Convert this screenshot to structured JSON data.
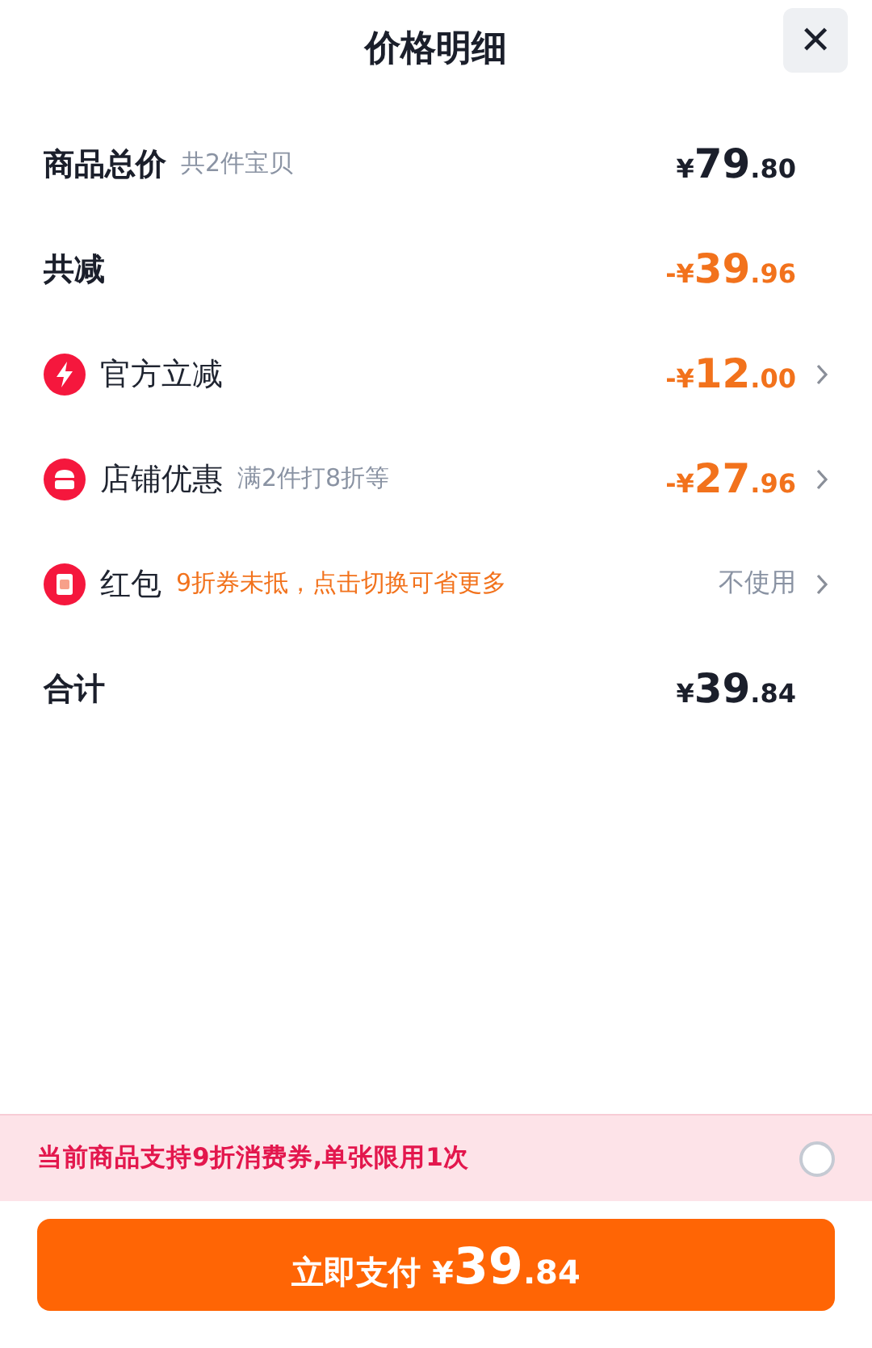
{
  "title": "价格明细",
  "close_label": "✕",
  "rows": [
    {
      "kind": "plain",
      "label": "商品总价",
      "note": "共2件宝贝",
      "note_highlight": false,
      "amount": {
        "prefix": "¥",
        "integer": "79",
        "decimal": ".80"
      },
      "amount_highlight": false,
      "has_arrow": false
    },
    {
      "kind": "plain",
      "label": "共减",
      "amount": {
        "prefix": "-¥",
        "integer": "39",
        "decimal": ".96"
      },
      "amount_highlight": true,
      "has_arrow": false
    },
    {
      "kind": "bolt",
      "label": "官方立减",
      "amount": {
        "prefix": "-¥",
        "integer": "12",
        "decimal": ".00"
      },
      "amount_highlight": true,
      "has_arrow": true
    },
    {
      "kind": "store",
      "label": "店铺优惠",
      "note": "满2件打8折等",
      "note_highlight": false,
      "amount": {
        "prefix": "-¥",
        "integer": "27",
        "decimal": ".96"
      },
      "amount_highlight": true,
      "has_arrow": true
    },
    {
      "kind": "packet",
      "label": "红包",
      "note": "9折券未抵，点击切换可省更多",
      "note_highlight": true,
      "value": "不使用",
      "has_arrow": true
    },
    {
      "kind": "plain",
      "label": "合计",
      "amount": {
        "prefix": "¥",
        "integer": "39",
        "decimal": ".84"
      },
      "amount_highlight": false,
      "has_arrow": false
    }
  ],
  "coupon": {
    "text": "当前商品支持9折消费券,单张限用1次",
    "selected": false
  },
  "pay_button": {
    "label": "立即支付",
    "amount": {
      "prefix": "¥",
      "integer": "39",
      "decimal": ".84"
    }
  }
}
